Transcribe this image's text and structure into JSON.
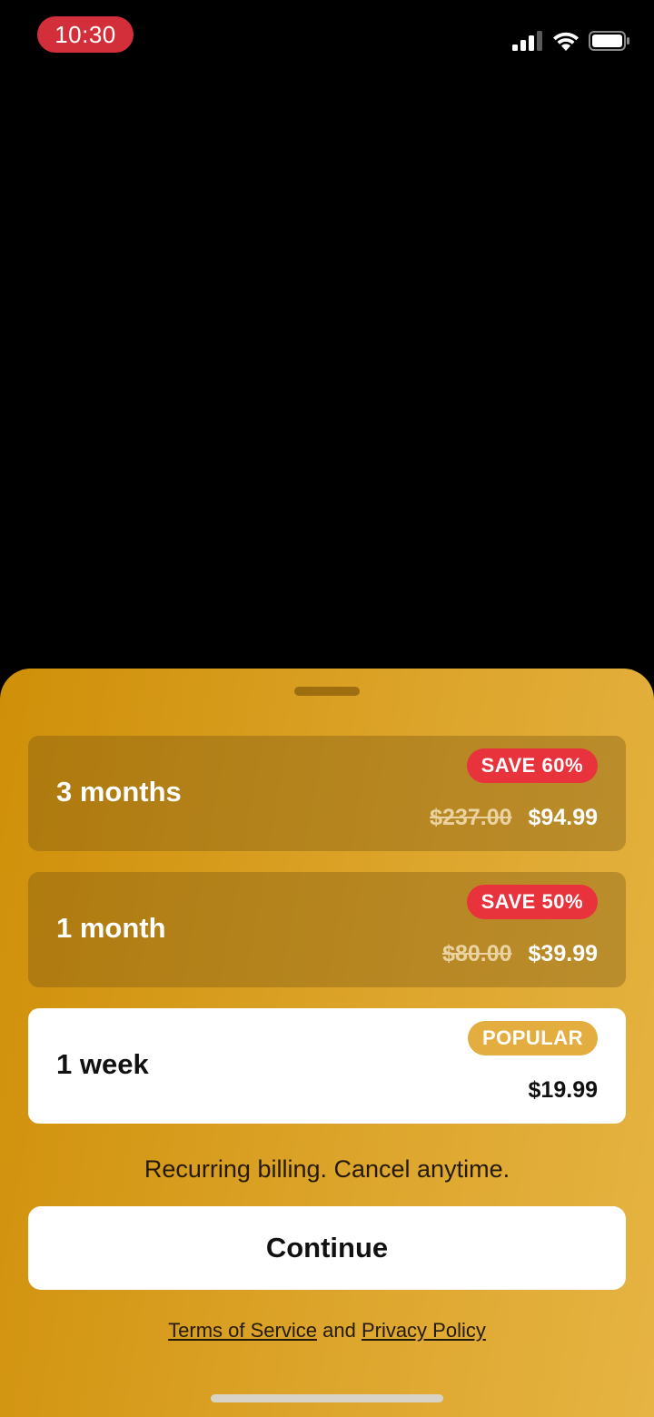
{
  "status_bar": {
    "time": "10:30",
    "icons": [
      "cellular-signal-icon",
      "wifi-icon",
      "battery-icon"
    ],
    "time_pill_color": "#d32f3a"
  },
  "plans": [
    {
      "name": "3 months",
      "badge": "SAVE 60%",
      "old_price": "$237.00",
      "price": "$94.99",
      "selected": false
    },
    {
      "name": "1 month",
      "badge": "SAVE 50%",
      "old_price": "$80.00",
      "price": "$39.99",
      "selected": false
    },
    {
      "name": "1 week",
      "badge": "POPULAR",
      "price": "$19.99",
      "selected": true
    }
  ],
  "billing_note": "Recurring billing. Cancel anytime.",
  "continue_label": "Continue",
  "legal": {
    "terms": "Terms of Service",
    "conjunction": "and",
    "privacy": "Privacy Policy"
  },
  "colors": {
    "sheet_gradient_start": "#cf8f08",
    "sheet_gradient_end": "#e6b443",
    "save_badge": "#e8323c",
    "popular_badge": "#e3ad3f"
  }
}
